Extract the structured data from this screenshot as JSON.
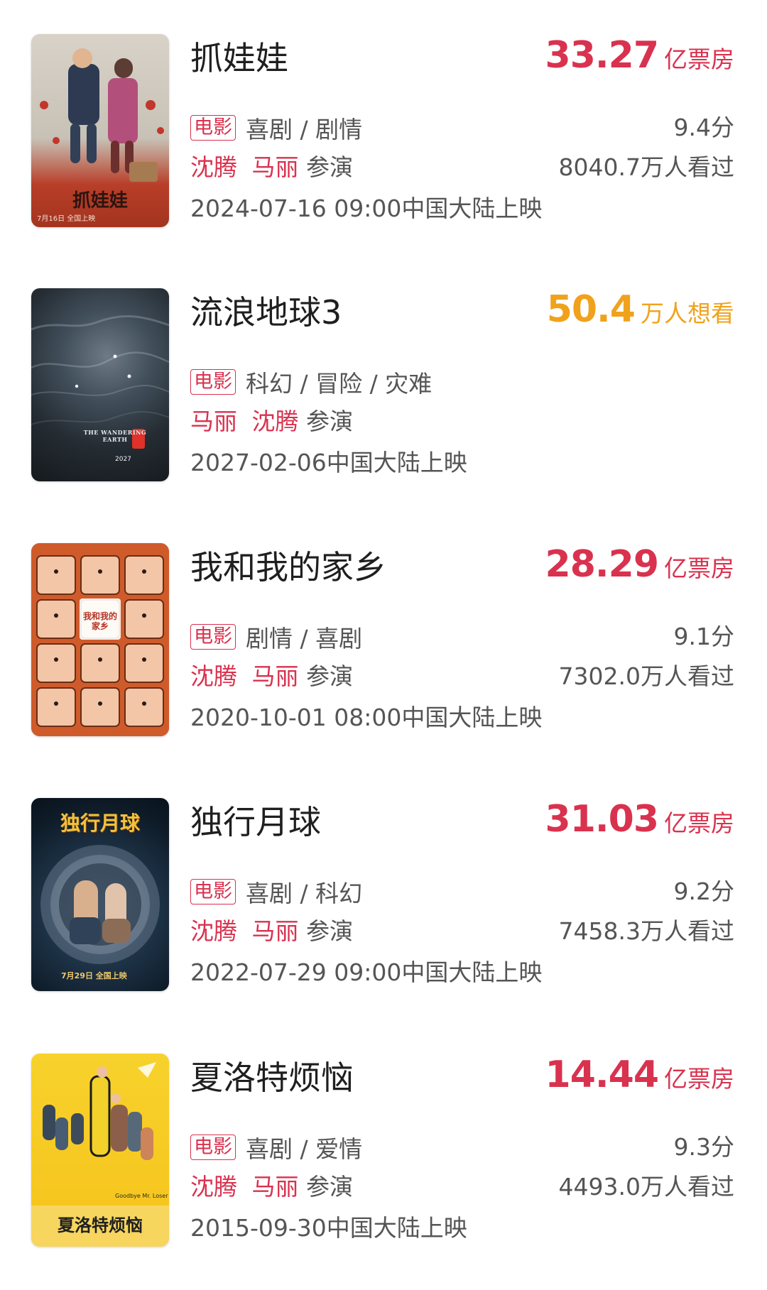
{
  "colors": {
    "box_office": "#d9324f",
    "want_to_see": "#f0a21c",
    "actor": "#d9324f",
    "badge": "#d9324f",
    "text_secondary": "#555555"
  },
  "movies": [
    {
      "title": "抓娃娃",
      "metric_value": "33.27",
      "metric_unit": "亿票房",
      "metric_kind": "box_office",
      "badge": "电影",
      "genres": "喜剧 / 剧情",
      "score": "9.4分",
      "actors": [
        "沈腾",
        "马丽"
      ],
      "cast_suffix": "参演",
      "viewers": "8040.7万人看过",
      "release": "2024-07-16 09:00中国大陆上映",
      "poster": {
        "title": "抓娃娃",
        "date": "7月16日 全国上映",
        "theme": "warm-street"
      }
    },
    {
      "title": "流浪地球3",
      "metric_value": "50.4",
      "metric_unit": "万人想看",
      "metric_kind": "want_to_see",
      "badge": "电影",
      "genres": "科幻 / 冒险 / 灾难",
      "score": "",
      "actors": [
        "马丽",
        "沈腾"
      ],
      "cast_suffix": "参演",
      "viewers": "",
      "release": "2027-02-06中国大陆上映",
      "poster": {
        "title": "THE WANDERING EARTH",
        "date": "2027",
        "theme": "dark-earth"
      }
    },
    {
      "title": "我和我的家乡",
      "metric_value": "28.29",
      "metric_unit": "亿票房",
      "metric_kind": "box_office",
      "badge": "电影",
      "genres": "剧情 / 喜剧",
      "score": "9.1分",
      "actors": [
        "沈腾",
        "马丽"
      ],
      "cast_suffix": "参演",
      "viewers": "7302.0万人看过",
      "release": "2020-10-01 08:00中国大陆上映",
      "poster": {
        "title": "我和我的家乡",
        "date": "",
        "theme": "orange-grid"
      }
    },
    {
      "title": "独行月球",
      "metric_value": "31.03",
      "metric_unit": "亿票房",
      "metric_kind": "box_office",
      "badge": "电影",
      "genres": "喜剧 / 科幻",
      "score": "9.2分",
      "actors": [
        "沈腾",
        "马丽"
      ],
      "cast_suffix": "参演",
      "viewers": "7458.3万人看过",
      "release": "2022-07-29 09:00中国大陆上映",
      "poster": {
        "title": "独行月球",
        "date": "7月29日 全国上映",
        "theme": "space-portal"
      }
    },
    {
      "title": "夏洛特烦恼",
      "metric_value": "14.44",
      "metric_unit": "亿票房",
      "metric_kind": "box_office",
      "badge": "电影",
      "genres": "喜剧 / 爱情",
      "score": "9.3分",
      "actors": [
        "沈腾",
        "马丽"
      ],
      "cast_suffix": "参演",
      "viewers": "4493.0万人看过",
      "release": "2015-09-30中国大陆上映",
      "poster": {
        "title": "夏洛特烦恼",
        "date": "Goodbye Mr. Loser",
        "theme": "yellow-cast"
      }
    }
  ]
}
